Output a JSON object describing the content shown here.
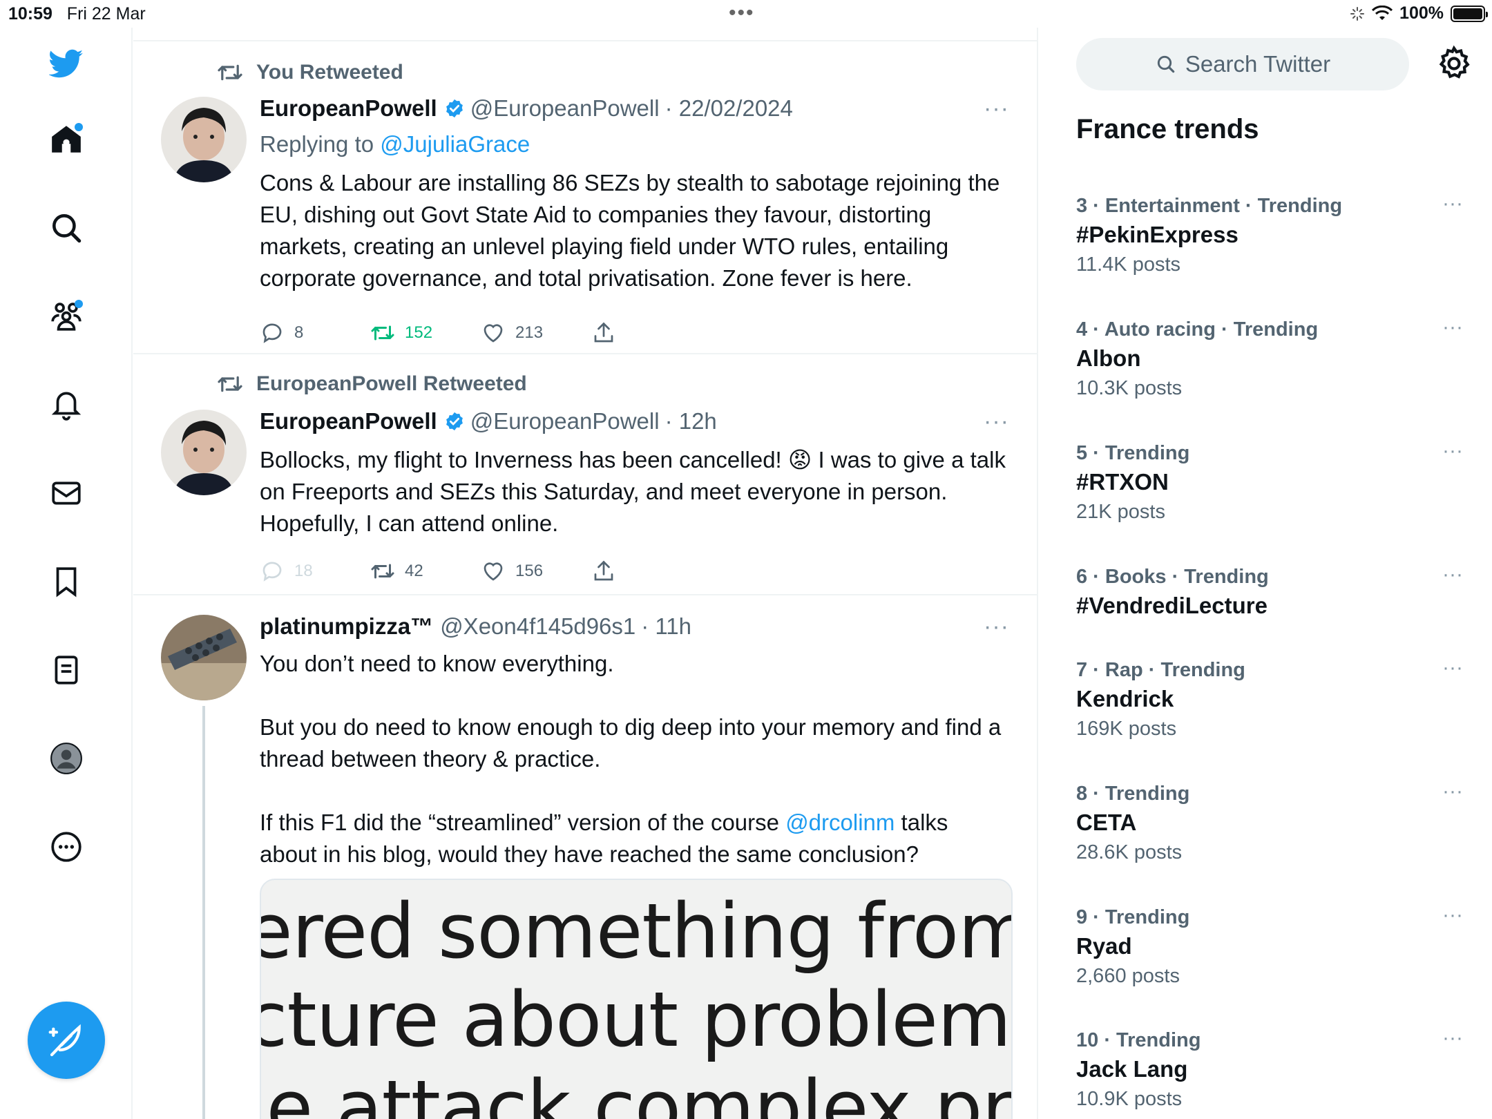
{
  "status_bar": {
    "time": "10:59",
    "date": "Fri 22 Mar",
    "battery": "100%",
    "battery_level": 1.0,
    "dots": "•••"
  },
  "compose_label": "Compose",
  "tweets": [
    {
      "retweet_label": "You Retweeted",
      "name": "EuropeanPowell",
      "handle": "@EuropeanPowell",
      "time": "· 22/02/2024",
      "replying_prefix": "Replying to ",
      "replying_to": "@JujuliaGrace",
      "body": "Cons & Labour are installing 86 SEZs by stealth to sabotage rejoining the EU, dishing out Govt State Aid to companies they favour, distorting markets, creating an unlevel playing field under WTO rules, entailing corporate governance, and total privatisation. Zone fever is here.",
      "replies": "8",
      "retweets": "152",
      "likes": "213"
    },
    {
      "retweet_label": "EuropeanPowell Retweeted",
      "name": "EuropeanPowell",
      "handle": "@EuropeanPowell",
      "time": "· 12h",
      "body_part1": "Bollocks, my flight to Inverness has been cancelled! ",
      "emoji": "😡",
      "body_part2": " I was to give a talk on Freeports and SEZs this Saturday, and meet everyone in person. Hopefully, I can attend online.",
      "replies": "18",
      "retweets": "42",
      "likes": "156"
    },
    {
      "name": "platinumpizza™",
      "handle": "@Xeon4f145d96s1",
      "time": "· 11h",
      "body_p1": "You don’t need to know everything.",
      "body_p2": "But you do need to know enough to dig deep into your memory and find a thread between theory & practice.",
      "body_p3a": "If this F1 did the “streamlined” version of the course ",
      "body_p3_link": "@drcolinm",
      "body_p3b": " talks about in his blog, would they have reached the same conclusion?",
      "media_lines": [
        "ered something from a",
        "cture about problems w",
        "ie attack complex predi"
      ]
    }
  ],
  "more_glyph": "···",
  "search_placeholder": "Search Twitter",
  "trends_title": "France trends",
  "trends": [
    {
      "meta": "3 · Entertainment · Trending",
      "name": "#PekinExpress",
      "count": "11.4K posts"
    },
    {
      "meta": "4 · Auto racing · Trending",
      "name": "Albon",
      "count": "10.3K posts"
    },
    {
      "meta": "5 · Trending",
      "name": "#RTXON",
      "count": "21K posts"
    },
    {
      "meta": "6 · Books · Trending",
      "name": "#VendrediLecture",
      "count": ""
    },
    {
      "meta": "7 · Rap · Trending",
      "name": "Kendrick",
      "count": "169K posts"
    },
    {
      "meta": "8 · Trending",
      "name": "CETA",
      "count": "28.6K posts"
    },
    {
      "meta": "9 · Trending",
      "name": "Ryad",
      "count": "2,660 posts"
    },
    {
      "meta": "10 · Trending",
      "name": "Jack Lang",
      "count": "10.9K posts"
    }
  ],
  "colors": {
    "accent": "#1d9bf0",
    "retweet_green": "#00ba7c",
    "muted": "#536471"
  }
}
